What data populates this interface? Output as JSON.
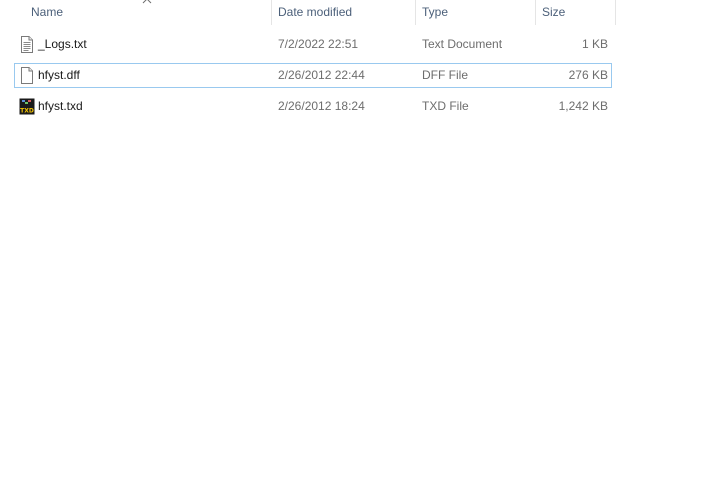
{
  "columns": {
    "name": "Name",
    "date_modified": "Date modified",
    "type": "Type",
    "size": "Size"
  },
  "sort": {
    "column": "name",
    "direction": "ascending",
    "icon": "chevron-up-icon"
  },
  "files": [
    {
      "name": "_Logs.txt",
      "date_modified": "7/2/2022 22:51",
      "type": "Text Document",
      "size": "1 KB",
      "icon": "text-document-icon",
      "focused": false
    },
    {
      "name": "hfyst.dff",
      "date_modified": "2/26/2012 22:44",
      "type": "DFF File",
      "size": "276 KB",
      "icon": "blank-file-icon",
      "focused": true
    },
    {
      "name": "hfyst.txd",
      "date_modified": "2/26/2012 18:24",
      "type": "TXD File",
      "size": "1,242 KB",
      "icon": "txd-file-icon",
      "focused": false
    }
  ],
  "colors": {
    "header_text": "#4c607a",
    "focus_border": "#99c9ef",
    "txd_icon_bg": "#1a1a1a",
    "txd_icon_text": "#f2c200"
  }
}
